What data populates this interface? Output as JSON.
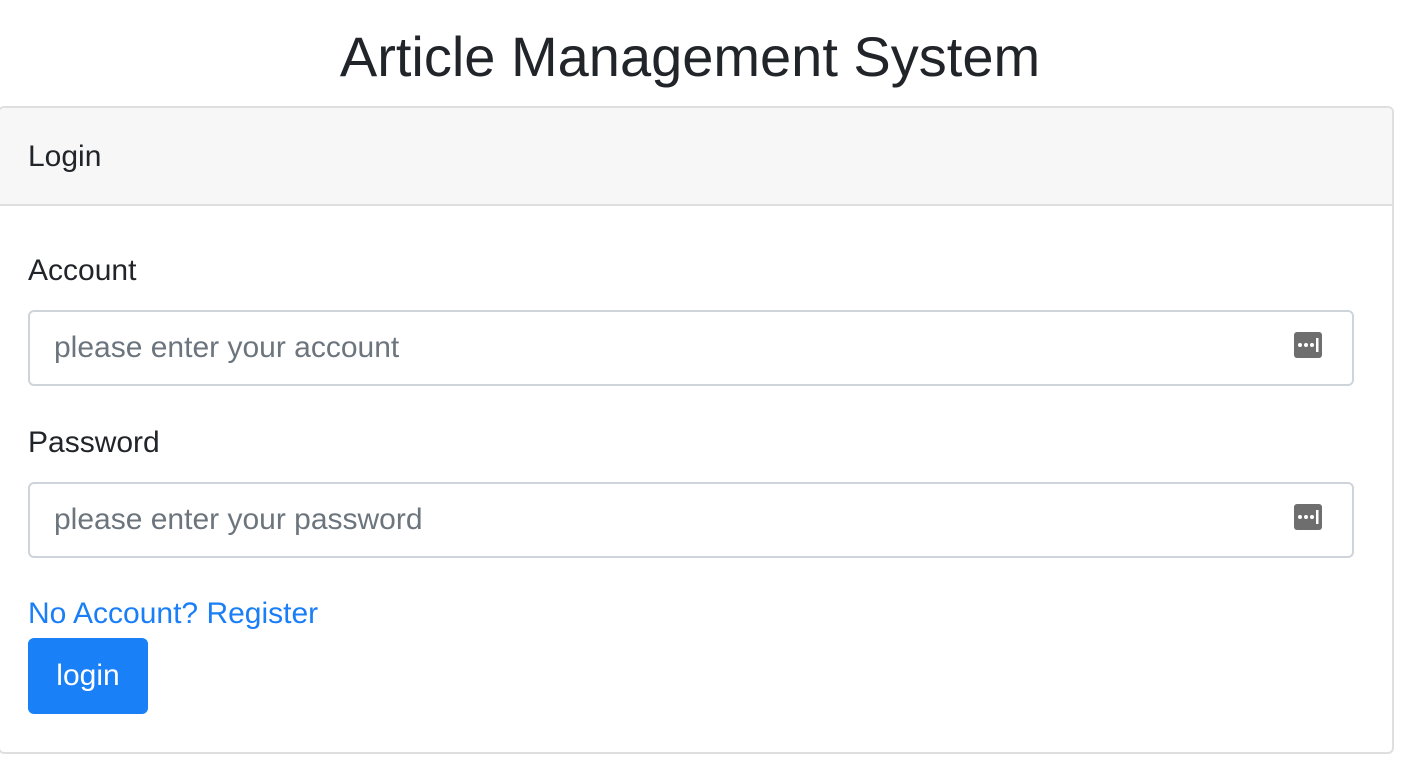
{
  "page": {
    "title": "Article Management System"
  },
  "card": {
    "header": "Login"
  },
  "form": {
    "account": {
      "label": "Account",
      "placeholder": "please enter your account",
      "value": ""
    },
    "password": {
      "label": "Password",
      "placeholder": "please enter your password",
      "value": ""
    },
    "register_link": "No Account? Register",
    "submit_label": "login"
  },
  "icons": {
    "autofill": "password-manager-key-icon"
  },
  "colors": {
    "primary": "#1a80f8",
    "link": "#1a7ef7",
    "header_bg": "#f7f7f7",
    "border": "#dfdfdf"
  }
}
